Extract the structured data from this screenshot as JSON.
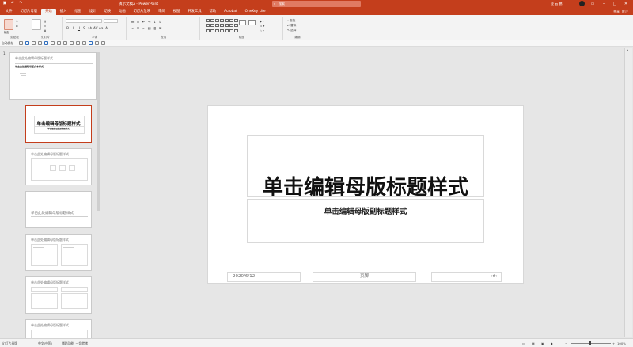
{
  "titlebar": {
    "title": "演示文稿2 - PowerPoint",
    "search_placeholder": "搜索",
    "user": "夏 云 鹏"
  },
  "tabs": [
    "文件",
    "幻灯片母版",
    "开始",
    "插入",
    "绘图",
    "设计",
    "切换",
    "动画",
    "幻灯片放映",
    "审阅",
    "视图",
    "开发工具",
    "帮助",
    "Acrobat",
    "OneKey Lite"
  ],
  "active_tab": "开始",
  "tabs_right": [
    "共享",
    "批注"
  ],
  "ribbon": {
    "groups": [
      "剪贴板",
      "幻灯片",
      "字体",
      "段落",
      "绘图",
      "编辑"
    ],
    "find": "查找",
    "replace": "替换",
    "select": "选择",
    "new_slide": "新建\n幻灯片",
    "paste": "粘贴"
  },
  "qat": {
    "label": "自动保存"
  },
  "thumbnails": {
    "master_title": "单击此处编辑母版标题样式",
    "master_body": "单击此处编辑母版文本样式",
    "t1": "单击编辑母版标题样式",
    "t1_sub": "单击编辑母版副标题样式",
    "t2": "单击此处编辑母版标题样式",
    "t3": "单击此处编辑母版标题样式",
    "t4": "单击此处编辑母版标题样式",
    "t5": "单击此处编辑母版标题样式",
    "t6": "单击此处编辑母版标题样式",
    "slide_number": "1"
  },
  "slide": {
    "title": "单击编辑母版标题样式",
    "subtitle": "单击编辑母版副标题样式",
    "date": "2020/6/12",
    "footer": "页脚",
    "page": "‹#›"
  },
  "status": {
    "left": "幻灯片母版",
    "lang": "中文(中国)",
    "accessibility": "辅助功能: 一切就绪",
    "zoom": "100%"
  }
}
